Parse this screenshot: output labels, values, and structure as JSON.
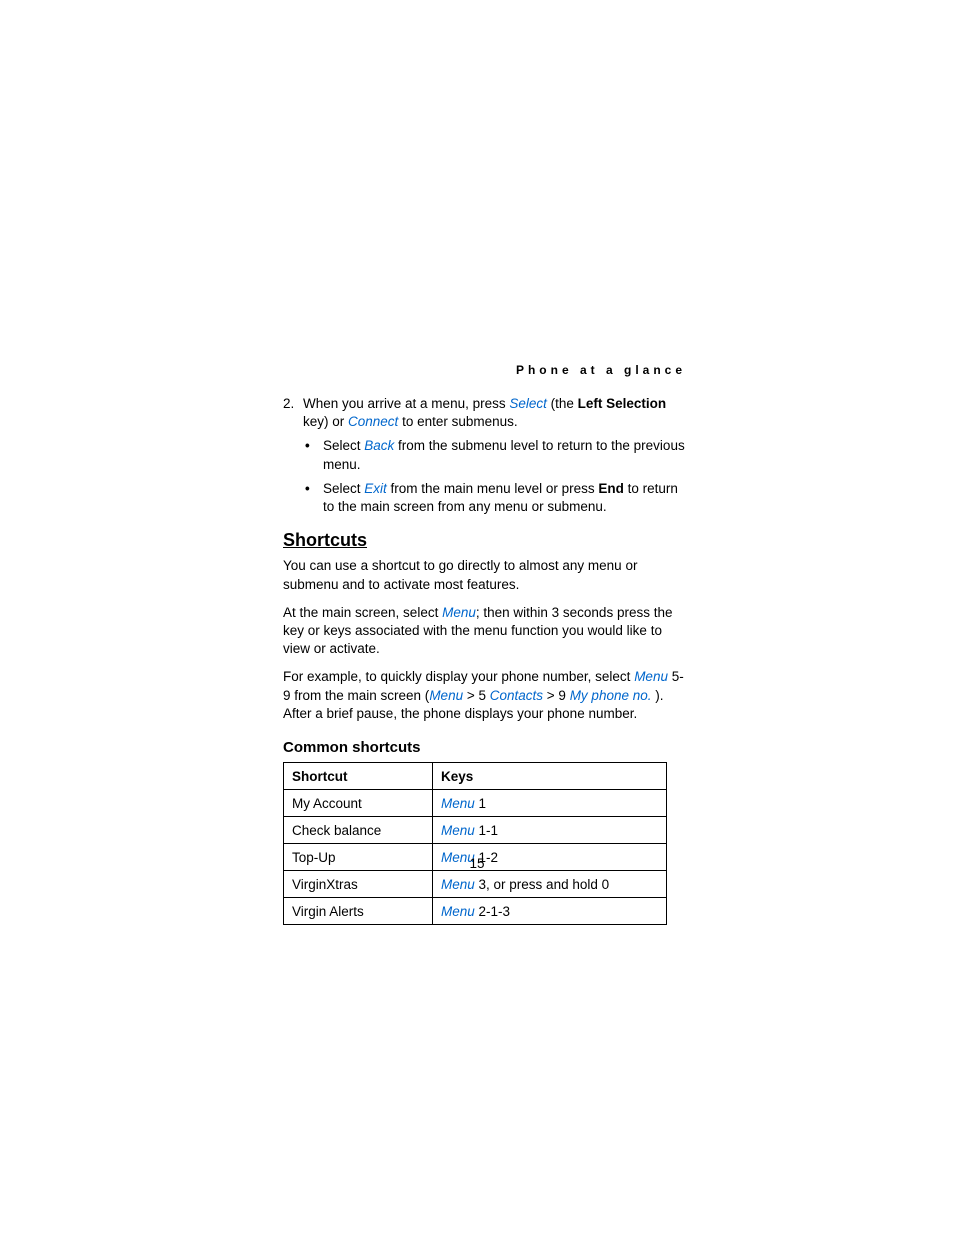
{
  "header": {
    "running": "Phone at a glance"
  },
  "step2": {
    "marker": "2.",
    "t1": "When you arrive at a menu, press ",
    "select": "Select",
    "t2": " (the ",
    "ls": "Left Selection",
    "t3": " key) or ",
    "connect": "Connect",
    "t4": " to enter submenus."
  },
  "sub1": {
    "pre": "Select ",
    "back": "Back",
    "post": " from the submenu level to return to the previous menu."
  },
  "sub2": {
    "pre": "Select ",
    "exit": "Exit",
    "mid": " from the main menu level or press ",
    "end": "End",
    "post": " to return to the main screen from any menu or submenu."
  },
  "h2": "Shortcuts",
  "p1": "You can use a shortcut to go directly to almost any menu or submenu and to activate most features.",
  "p2": {
    "t1": "At the main screen, select ",
    "menu": "Menu",
    "t2": "; then within 3 seconds press the key or keys associated with the menu function you would like to view or activate."
  },
  "p3": {
    "t1": "For example, to quickly display your phone number, select ",
    "menu1": "Menu",
    "t2": " 5-9 from the main screen (",
    "menu2": "Menu",
    "t3": " > 5 ",
    "contacts": "Contacts",
    "t4": "  > 9 ",
    "mypno": "My phone no.",
    "t5": " ). After a brief pause, the phone displays your phone number."
  },
  "h3": "Common shortcuts",
  "table": {
    "h1": "Shortcut",
    "h2": "Keys",
    "rows": [
      {
        "s": "My Account",
        "m": "Menu",
        "k": " 1"
      },
      {
        "s": "Check balance",
        "m": "Menu",
        "k": " 1-1"
      },
      {
        "s": "Top-Up",
        "m": "Menu",
        "k": " 1-2"
      },
      {
        "s": "VirginXtras",
        "m": "Menu",
        "k": " 3, or press and hold 0"
      },
      {
        "s": "Virgin Alerts",
        "m": "Menu",
        "k": " 2-1-3"
      }
    ]
  },
  "page_number": "15"
}
